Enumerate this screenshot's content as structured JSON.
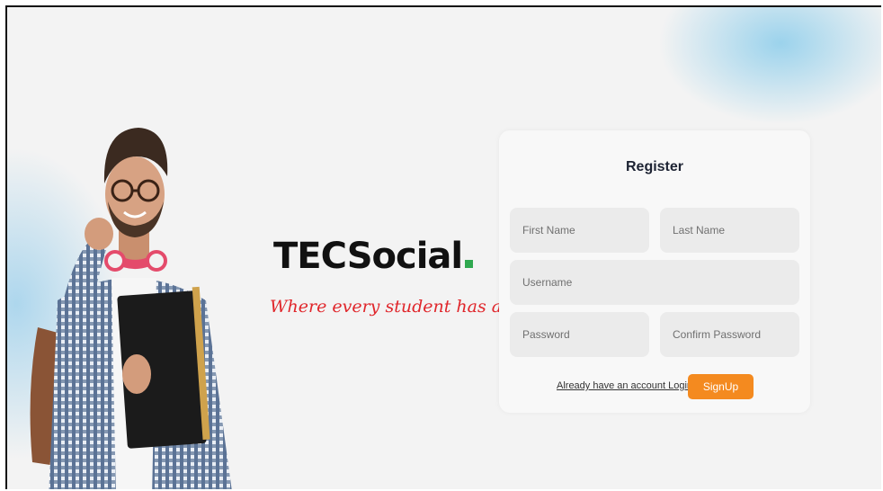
{
  "brand": {
    "name": "TECSocial",
    "tagline": "Where every student has a voice!"
  },
  "register": {
    "title": "Register",
    "first_name_placeholder": "First Name",
    "last_name_placeholder": "Last Name",
    "username_placeholder": "Username",
    "password_placeholder": "Password",
    "confirm_password_placeholder": "Confirm Password",
    "login_link": "Already have an account Login",
    "signup_label": "SignUp"
  },
  "colors": {
    "accent": "#f48a1f",
    "brand_dot": "#2fa84f",
    "tagline": "#e0262b",
    "background_glow": "#8ccdeb"
  },
  "icons": [
    "student-photo"
  ]
}
